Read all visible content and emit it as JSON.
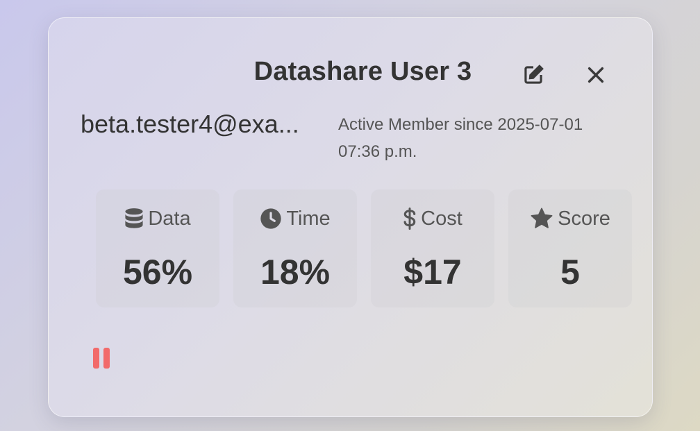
{
  "card": {
    "title": "Datashare User 3",
    "email": "beta.tester4@exa...",
    "member_line1": "Active Member since 2025-07-01",
    "member_line2": "07:36 p.m.",
    "actions": {
      "edit_icon": "edit-icon",
      "close_icon": "close-icon"
    }
  },
  "stats": [
    {
      "icon": "database-icon",
      "label": "Data",
      "value": "56%"
    },
    {
      "icon": "clock-icon",
      "label": "Time",
      "value": "18%"
    },
    {
      "icon": "dollar-icon",
      "label": "Cost",
      "value": "$17"
    },
    {
      "icon": "star-icon",
      "label": "Score",
      "value": "5"
    }
  ],
  "controls": {
    "pause_icon": "pause-icon"
  },
  "colors": {
    "pause": "#f26a6a",
    "text_dark": "#333333",
    "text_muted": "#555555"
  }
}
